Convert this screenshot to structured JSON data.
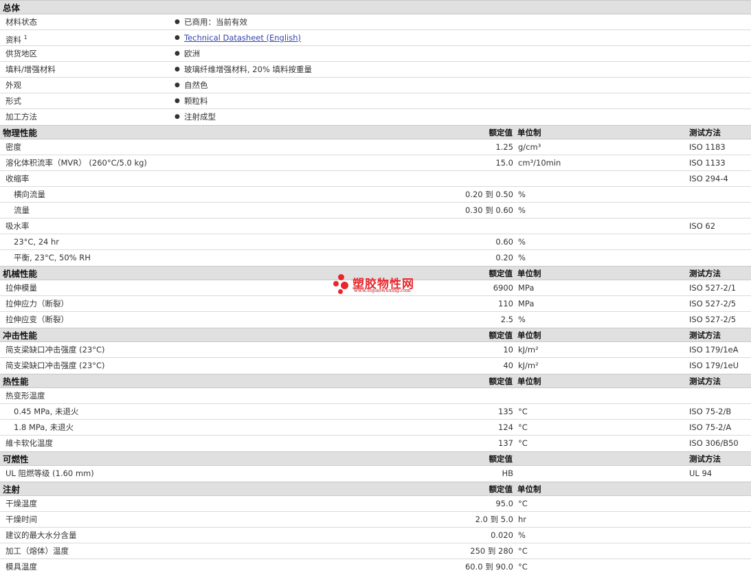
{
  "general": {
    "title": "总体",
    "rows": [
      {
        "label": "材料状态",
        "value": "已商用：当前有效"
      },
      {
        "label": "资料",
        "sup": "1",
        "value": "Technical Datasheet (English)",
        "link": true
      },
      {
        "label": "供货地区",
        "value": "欧洲"
      },
      {
        "label": "填料/增强材料",
        "value": "玻璃纤维增强材料, 20% 填料按重量"
      },
      {
        "label": "外观",
        "value": "自然色"
      },
      {
        "label": "形式",
        "value": "颗粒料"
      },
      {
        "label": "加工方法",
        "value": "注射成型"
      }
    ]
  },
  "sections": [
    {
      "title": "物理性能",
      "h_value": "额定值",
      "h_unit": "单位制",
      "h_test": "测试方法",
      "rows": [
        {
          "label": "密度",
          "value": "1.25",
          "unit": "g/cm³",
          "test": "ISO 1183"
        },
        {
          "label": "溶化体积流率（MVR） (260°C/5.0 kg)",
          "value": "15.0",
          "unit": "cm³/10min",
          "test": "ISO 1133"
        },
        {
          "label": "收缩率",
          "test": "ISO 294-4"
        },
        {
          "label": "横向流量",
          "indent": true,
          "value": "0.20 到  0.50",
          "unit": "%"
        },
        {
          "label": "流量",
          "indent": true,
          "value": "0.30 到  0.60",
          "unit": "%"
        },
        {
          "label": "吸水率",
          "test": "ISO 62"
        },
        {
          "label": "23°C, 24 hr",
          "indent": true,
          "value": "0.60",
          "unit": "%"
        },
        {
          "label": "平衡, 23°C, 50% RH",
          "indent": true,
          "value": "0.20",
          "unit": "%"
        }
      ]
    },
    {
      "title": "机械性能",
      "h_value": "额定值",
      "h_unit": "单位制",
      "h_test": "测试方法",
      "rows": [
        {
          "label": "拉伸模量",
          "value": "6900",
          "unit": "MPa",
          "test": "ISO 527-2/1"
        },
        {
          "label": "拉伸应力（断裂）",
          "value": "110",
          "unit": "MPa",
          "test": "ISO 527-2/5"
        },
        {
          "label": "拉伸应变（断裂）",
          "value": "2.5",
          "unit": "%",
          "test": "ISO 527-2/5"
        }
      ]
    },
    {
      "title": "冲击性能",
      "h_value": "额定值",
      "h_unit": "单位制",
      "h_test": "测试方法",
      "rows": [
        {
          "label": "简支梁缺口冲击强度 (23°C)",
          "value": "10",
          "unit": "kJ/m²",
          "test": "ISO 179/1eA"
        },
        {
          "label": "简支梁缺口冲击强度 (23°C)",
          "value": "40",
          "unit": "kJ/m²",
          "test": "ISO 179/1eU"
        }
      ]
    },
    {
      "title": "热性能",
      "h_value": "额定值",
      "h_unit": "单位制",
      "h_test": "测试方法",
      "rows": [
        {
          "label": "热变形温度"
        },
        {
          "label": "0.45 MPa, 未退火",
          "indent": true,
          "value": "135",
          "unit": "°C",
          "test": "ISO 75-2/B"
        },
        {
          "label": "1.8 MPa, 未退火",
          "indent": true,
          "value": "124",
          "unit": "°C",
          "test": "ISO 75-2/A"
        },
        {
          "label": "維卡软化温度",
          "value": "137",
          "unit": "°C",
          "test": "ISO 306/B50"
        }
      ]
    },
    {
      "title": "可燃性",
      "h_value": "额定值",
      "h_unit": "",
      "h_test": "测试方法",
      "rows": [
        {
          "label": "UL 阻燃等级 (1.60 mm)",
          "value": "HB",
          "test": "UL 94"
        }
      ]
    },
    {
      "title": "注射",
      "h_value": "额定值",
      "h_unit": "单位制",
      "h_test": "",
      "rows": [
        {
          "label": "干燥温度",
          "value": "95.0",
          "unit": "°C"
        },
        {
          "label": "干燥时间",
          "value": "2.0 到  5.0",
          "unit": "hr"
        },
        {
          "label": "建议的最大水分含量",
          "value": "0.020",
          "unit": "%"
        },
        {
          "label": "加工（熔体）温度",
          "value": "250 到  280",
          "unit": "°C"
        },
        {
          "label": "模具温度",
          "value": "60.0 到  90.0",
          "unit": "°C"
        }
      ]
    }
  ],
  "watermark": {
    "name": "塑胶物性网",
    "url": "www.sujiaowuxing.com",
    "color": "#e8262c"
  }
}
